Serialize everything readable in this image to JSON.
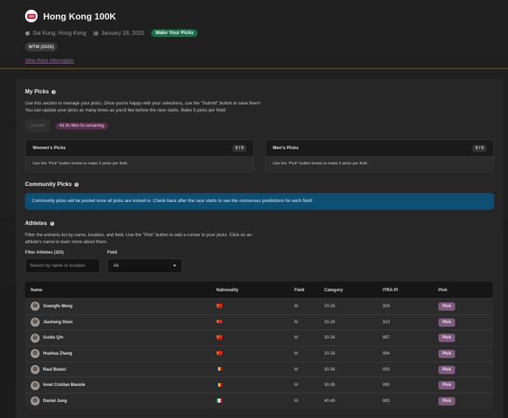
{
  "race": {
    "title": "Hong Kong 100K",
    "location": "Sai Kung, Hong Kong",
    "date": "January 18, 2025",
    "status_badge": "Make Your Picks",
    "tag": "WTM (2025)",
    "info_link": "View Race Information",
    "logo_text": "100"
  },
  "my_picks": {
    "title": "My Picks",
    "description": "Use this section to manage your picks. Once you're happy with your selections, use the \"Submit\" button to save them! You can update your picks as many times as you'd like before the race starts. Make 5 picks per field!",
    "submit_label": "Submit",
    "timer": "4d 2h 48m 0s remaining",
    "boxes": [
      {
        "label": "Women's Picks",
        "count": "0 / 5",
        "hint": "Use the \"Pick\" button below to make 5 picks per field."
      },
      {
        "label": "Men's Picks",
        "count": "0 / 5",
        "hint": "Use the \"Pick\" button below to make 5 picks per field."
      }
    ]
  },
  "community": {
    "title": "Community Picks",
    "note": "Community picks will be posted once all picks are locked in. Check back after the race starts to see the consensus predictions for each field!"
  },
  "athletes": {
    "title": "Athletes",
    "description": "Filter the entrants list by name, location, and field. Use the \"Pick\" button to add a runner to your picks. Click on an athlete's name to learn more about them.",
    "filter_label": "Filter Athletes (323)",
    "filter_placeholder": "Search by name or location",
    "field_label": "Field",
    "field_value": "All",
    "columns": [
      "Name",
      "Nationality",
      "Field",
      "Category",
      "ITRA PI",
      "Pick"
    ],
    "pick_label": "Pick",
    "rows": [
      {
        "name": "Guangfu Meng",
        "flag": "cn",
        "field": "M",
        "category": "20-29",
        "itra": "924"
      },
      {
        "name": "Jiasheng Shen",
        "flag": "cn",
        "field": "M",
        "category": "20-29",
        "itra": "913"
      },
      {
        "name": "Guidu Qin",
        "flag": "cn",
        "field": "M",
        "category": "30-39",
        "itra": "897"
      },
      {
        "name": "Huahua Zhang",
        "flag": "cn",
        "field": "M",
        "category": "20-29",
        "itra": "894"
      },
      {
        "name": "Raul Butaci",
        "flag": "ro",
        "field": "M",
        "category": "30-39",
        "itra": "893"
      },
      {
        "name": "Ionel Cristian Manole",
        "flag": "ro",
        "field": "M",
        "category": "30-39",
        "itra": "890"
      },
      {
        "name": "Daniel Jung",
        "flag": "it",
        "field": "M",
        "category": "40-49",
        "itra": "883"
      }
    ]
  },
  "colors": {
    "accent_green": "#1f6b4a",
    "pick_button": "#7d5a7e",
    "note_blue": "#0d4e72",
    "timer_bg": "#5a2f4e"
  },
  "icons": {
    "location": "map-pin-icon",
    "date": "calendar-icon",
    "info": "info-icon",
    "select": "chevron-down-icon"
  }
}
